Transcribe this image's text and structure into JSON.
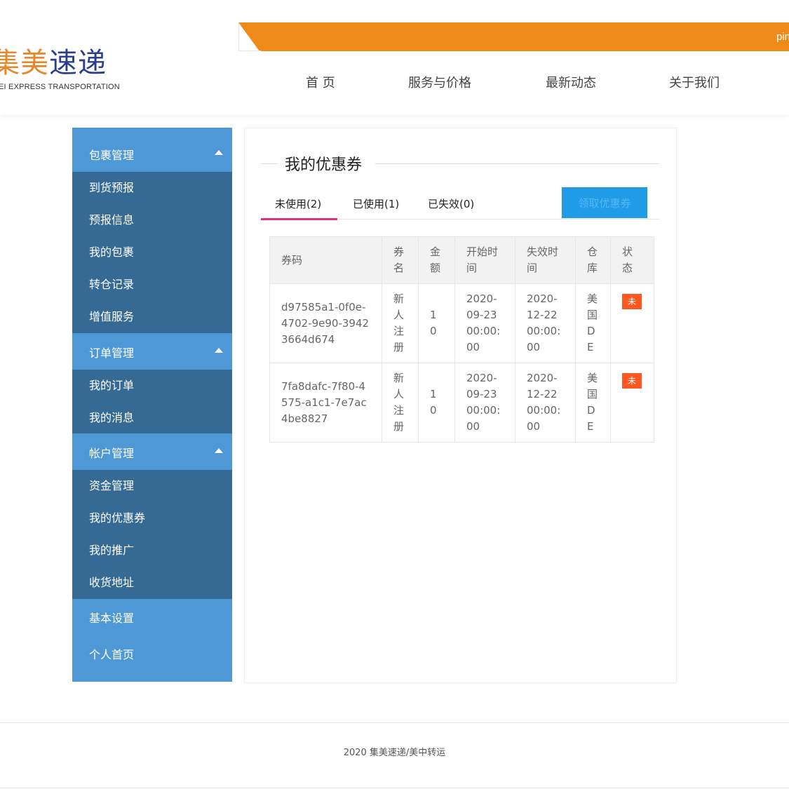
{
  "header": {
    "logo_cn_part1": "集美",
    "logo_cn_part2": "速递",
    "logo_en": "EI   EXPRESS TRANSPORTATION",
    "banner_text": "pin",
    "nav": [
      "首 页",
      "服务与价格",
      "最新动态",
      "关于我们"
    ]
  },
  "sidebar": {
    "groups": [
      {
        "label": "包裹管理",
        "items": [
          "到货预报",
          "预报信息",
          "我的包裹",
          "转仓记录",
          "增值服务"
        ]
      },
      {
        "label": "订单管理",
        "items": [
          "我的订单",
          "我的消息"
        ]
      },
      {
        "label": "帐户管理",
        "items": [
          "资金管理",
          "我的优惠券",
          "我的推广",
          "收货地址"
        ]
      }
    ],
    "plain": [
      "基本设置",
      "个人首页"
    ]
  },
  "main": {
    "title": "我的优惠券",
    "tabs": [
      "未使用(2)",
      "已使用(1)",
      "已失效(0)"
    ],
    "claim_button": "领取优惠券",
    "columns": [
      "券码",
      "券名",
      "金额",
      "开始时间",
      "失效时间",
      "仓库",
      "状态"
    ],
    "rows": [
      {
        "code": "d97585a1-0f0e-4702-9e90-39423664d674",
        "name": "新人注册",
        "amount": "10",
        "start": "2020-09-23 00:00:00",
        "end": "2020-12-22 00:00:00",
        "warehouse": "美国DE",
        "status": "未"
      },
      {
        "code": "7fa8dafc-7f80-4575-a1c1-7e7ac4be8827",
        "name": "新人注册",
        "amount": "10",
        "start": "2020-09-23 00:00:00",
        "end": "2020-12-22 00:00:00",
        "warehouse": "美国DE",
        "status": "未"
      }
    ]
  },
  "footer": {
    "text": "2020 集美速递/美中转运"
  },
  "colors": {
    "accent_orange": "#ee8a18",
    "sidebar_blue": "#4f98d6",
    "sidebar_dark": "#356a94",
    "tab_underline": "#e0347a",
    "badge_red": "#ff5722",
    "button_blue": "#1f9be8"
  }
}
